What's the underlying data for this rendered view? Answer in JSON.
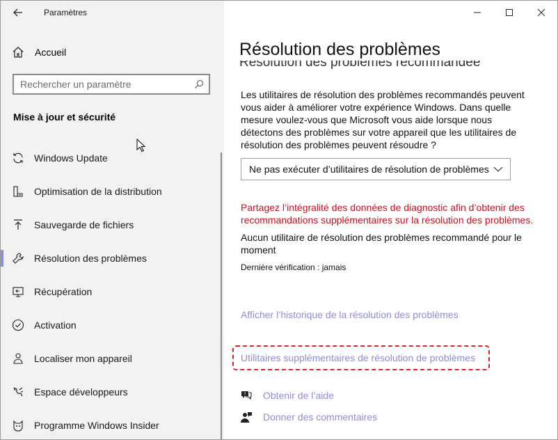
{
  "window": {
    "app_title": "Paramètres",
    "controls": {
      "minimize": "minimize-icon",
      "maximize": "maximize-icon",
      "close": "close-icon"
    }
  },
  "sidebar": {
    "home_label": "Accueil",
    "search_placeholder": "Rechercher un paramètre",
    "section_title": "Mise à jour et sécurité",
    "items": [
      {
        "label": "Windows Update",
        "icon": "sync-icon"
      },
      {
        "label": "Optimisation de la distribution",
        "icon": "delivery-optimization-icon"
      },
      {
        "label": "Sauvegarde de fichiers",
        "icon": "backup-arrow-icon"
      },
      {
        "label": "Résolution des problèmes",
        "icon": "wrench-icon",
        "active": true
      },
      {
        "label": "Récupération",
        "icon": "recovery-icon"
      },
      {
        "label": "Activation",
        "icon": "activation-check-icon"
      },
      {
        "label": "Localiser mon appareil",
        "icon": "person-locate-icon"
      },
      {
        "label": "Espace développeurs",
        "icon": "developer-tools-icon"
      },
      {
        "label": "Programme Windows Insider",
        "icon": "insider-cat-icon"
      }
    ]
  },
  "main": {
    "title": "Résolution des problèmes",
    "partially_hidden_heading": "Résolution des problèmes recommandée",
    "description": "Les utilitaires de résolution des problèmes recommandés peuvent vous aider à améliorer votre expérience Windows. Dans quelle mesure voulez-vous que Microsoft vous aide lorsque nous détectons des problèmes sur votre appareil que les utilitaires de résolution des problèmes peuvent résoudre ?",
    "dropdown_value": "Ne pas exécuter d’utilitaires de résolution de problèmes",
    "warning": "Partagez l’intégralité des données de diagnostic afin d’obtenir des recommandations supplémentaires sur la résolution des problèmes.",
    "no_result": "Aucun utilitaire de résolution des problèmes recommandé pour le moment",
    "last_check": "Dernière vérification : jamais",
    "history_link": "Afficher l’historique de la résolution des problèmes",
    "additional_link": "Utilitaires supplémentaires de résolution de problèmes",
    "help_link": "Obtenir de l’aide",
    "feedback_link": "Donner des commentaires"
  },
  "colors": {
    "accent": "#8d8dd8",
    "warning": "#c50f1f",
    "highlight": "#e0202a",
    "sidebar_bg": "#f2f2f2"
  }
}
